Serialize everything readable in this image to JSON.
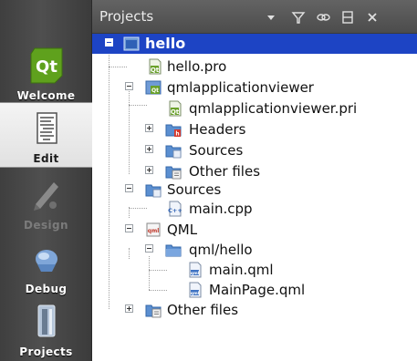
{
  "modes": [
    {
      "id": "welcome",
      "label": "Welcome",
      "icon": "qt-logo-icon",
      "state": "normal"
    },
    {
      "id": "edit",
      "label": "Edit",
      "icon": "edit-document-icon",
      "state": "active"
    },
    {
      "id": "design",
      "label": "Design",
      "icon": "design-pen-icon",
      "state": "disabled"
    },
    {
      "id": "debug",
      "label": "Debug",
      "icon": "debug-bug-icon",
      "state": "normal"
    },
    {
      "id": "projects",
      "label": "Projects",
      "icon": "projects-wrench-icon",
      "state": "normal"
    }
  ],
  "header": {
    "title": "Projects",
    "tools": [
      "dropdown-arrow-icon",
      "filter-icon",
      "link-icon",
      "split-icon",
      "close-icon"
    ]
  },
  "tree": [
    {
      "label": "hello",
      "icon": "project-icon",
      "expander": "minus",
      "selected": true
    },
    {
      "label": "hello.pro",
      "icon": "pro-file-icon"
    },
    {
      "label": "qmlapplicationviewer",
      "icon": "subproject-icon",
      "expander": "minus"
    },
    {
      "label": "qmlapplicationviewer.pri",
      "icon": "pri-file-icon"
    },
    {
      "label": "Headers",
      "icon": "headers-folder-icon",
      "expander": "plus"
    },
    {
      "label": "Sources",
      "icon": "sources-folder-icon",
      "expander": "plus"
    },
    {
      "label": "Other files",
      "icon": "other-files-folder-icon",
      "expander": "plus"
    },
    {
      "label": "Sources",
      "icon": "sources-folder-icon",
      "expander": "minus"
    },
    {
      "label": "main.cpp",
      "icon": "cpp-file-icon"
    },
    {
      "label": "QML",
      "icon": "qml-folder-icon",
      "expander": "minus"
    },
    {
      "label": "qml/hello",
      "icon": "folder-icon",
      "expander": "minus"
    },
    {
      "label": "main.qml",
      "icon": "qml-file-icon"
    },
    {
      "label": "MainPage.qml",
      "icon": "qml-file-icon"
    },
    {
      "label": "Other files",
      "icon": "other-files-folder-icon",
      "expander": "plus"
    }
  ],
  "colors": {
    "selection": "#1d44c4",
    "header_bg": "#565656",
    "sidebar_bg": "#454545"
  }
}
